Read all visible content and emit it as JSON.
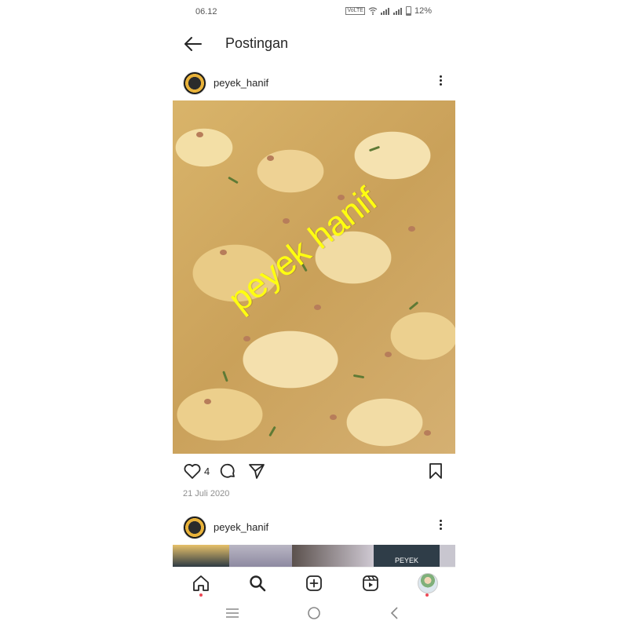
{
  "status_bar": {
    "time": "06.12",
    "network_label": "VoLTE",
    "battery": "12%"
  },
  "header": {
    "title": "Postingan",
    "back_icon": "arrow-left-icon"
  },
  "post": {
    "username": "peyek_hanif",
    "watermark": "peyek hanif",
    "likes": "4",
    "date": "21 Juli 2020",
    "icons": [
      "heart-icon",
      "comment-icon",
      "share-icon",
      "bookmark-icon",
      "more-icon"
    ]
  },
  "next_post": {
    "username": "peyek_hanif",
    "thumbnail_text": "PEYEK"
  },
  "bottom_nav": [
    "home-icon",
    "search-icon",
    "add-post-icon",
    "reels-icon",
    "profile-avatar"
  ],
  "system_nav": [
    "menu-icon",
    "home-circle-icon",
    "back-chevron-icon"
  ],
  "colors": {
    "notification_dot": "#ed4956",
    "watermark": "#ffff10",
    "date_gray": "#8e8e8e"
  }
}
